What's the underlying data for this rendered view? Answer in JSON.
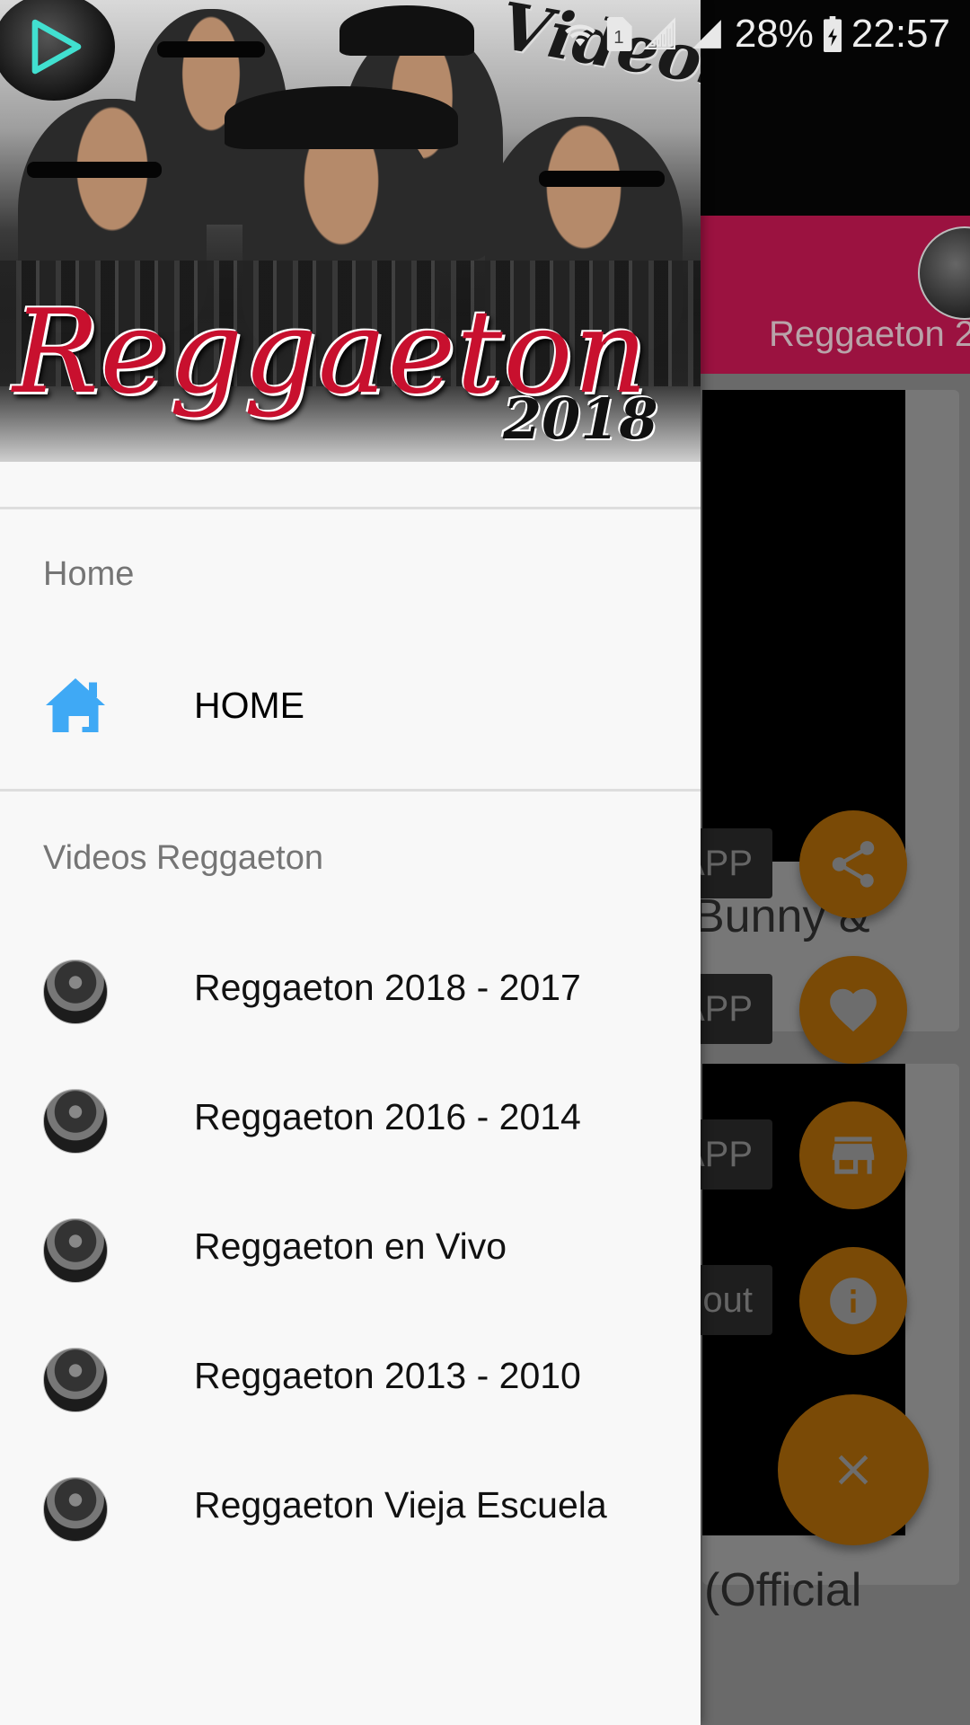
{
  "status_bar": {
    "battery": "28%",
    "time": "22:57",
    "icons": [
      "wifi-icon",
      "sim-1-icon",
      "signal-icon",
      "signal-icon",
      "battery-charging-icon"
    ]
  },
  "drawer": {
    "banner": {
      "title": "Reggaeton",
      "year": "2018",
      "videos_word": "Videos"
    },
    "sections": {
      "home_title": "Home",
      "videos_title": "Videos Reggaeton"
    },
    "home_item": {
      "label": "HOME",
      "icon": "home-icon",
      "icon_color": "#3fa9f5"
    },
    "items": [
      {
        "label": "Reggaeton 2018 - 2017"
      },
      {
        "label": "Reggaeton 2016 - 2014"
      },
      {
        "label": "Reggaeton en Vivo"
      },
      {
        "label": "Reggaeton 2013 - 2010"
      },
      {
        "label": "Reggaeton Vieja Escuela"
      }
    ]
  },
  "background": {
    "channel_title": "Reggaeton 2",
    "pills": [
      "APP",
      "APP",
      "APP",
      "out"
    ],
    "captions": [
      "Bunny &",
      "(Official"
    ],
    "fab_color": "#e8960c",
    "fabs": [
      "share-icon",
      "favorite-icon",
      "store-icon",
      "info-icon",
      "close-icon"
    ]
  }
}
